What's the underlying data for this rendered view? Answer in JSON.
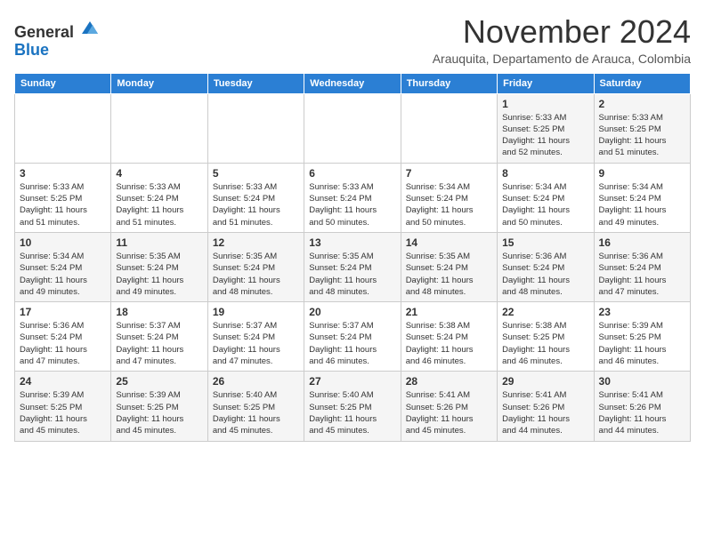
{
  "logo": {
    "general": "General",
    "blue": "Blue"
  },
  "title": "November 2024",
  "subtitle": "Arauquita, Departamento de Arauca, Colombia",
  "days_of_week": [
    "Sunday",
    "Monday",
    "Tuesday",
    "Wednesday",
    "Thursday",
    "Friday",
    "Saturday"
  ],
  "weeks": [
    [
      {
        "day": "",
        "info": ""
      },
      {
        "day": "",
        "info": ""
      },
      {
        "day": "",
        "info": ""
      },
      {
        "day": "",
        "info": ""
      },
      {
        "day": "",
        "info": ""
      },
      {
        "day": "1",
        "info": "Sunrise: 5:33 AM\nSunset: 5:25 PM\nDaylight: 11 hours\nand 52 minutes."
      },
      {
        "day": "2",
        "info": "Sunrise: 5:33 AM\nSunset: 5:25 PM\nDaylight: 11 hours\nand 51 minutes."
      }
    ],
    [
      {
        "day": "3",
        "info": "Sunrise: 5:33 AM\nSunset: 5:25 PM\nDaylight: 11 hours\nand 51 minutes."
      },
      {
        "day": "4",
        "info": "Sunrise: 5:33 AM\nSunset: 5:24 PM\nDaylight: 11 hours\nand 51 minutes."
      },
      {
        "day": "5",
        "info": "Sunrise: 5:33 AM\nSunset: 5:24 PM\nDaylight: 11 hours\nand 51 minutes."
      },
      {
        "day": "6",
        "info": "Sunrise: 5:33 AM\nSunset: 5:24 PM\nDaylight: 11 hours\nand 50 minutes."
      },
      {
        "day": "7",
        "info": "Sunrise: 5:34 AM\nSunset: 5:24 PM\nDaylight: 11 hours\nand 50 minutes."
      },
      {
        "day": "8",
        "info": "Sunrise: 5:34 AM\nSunset: 5:24 PM\nDaylight: 11 hours\nand 50 minutes."
      },
      {
        "day": "9",
        "info": "Sunrise: 5:34 AM\nSunset: 5:24 PM\nDaylight: 11 hours\nand 49 minutes."
      }
    ],
    [
      {
        "day": "10",
        "info": "Sunrise: 5:34 AM\nSunset: 5:24 PM\nDaylight: 11 hours\nand 49 minutes."
      },
      {
        "day": "11",
        "info": "Sunrise: 5:35 AM\nSunset: 5:24 PM\nDaylight: 11 hours\nand 49 minutes."
      },
      {
        "day": "12",
        "info": "Sunrise: 5:35 AM\nSunset: 5:24 PM\nDaylight: 11 hours\nand 48 minutes."
      },
      {
        "day": "13",
        "info": "Sunrise: 5:35 AM\nSunset: 5:24 PM\nDaylight: 11 hours\nand 48 minutes."
      },
      {
        "day": "14",
        "info": "Sunrise: 5:35 AM\nSunset: 5:24 PM\nDaylight: 11 hours\nand 48 minutes."
      },
      {
        "day": "15",
        "info": "Sunrise: 5:36 AM\nSunset: 5:24 PM\nDaylight: 11 hours\nand 48 minutes."
      },
      {
        "day": "16",
        "info": "Sunrise: 5:36 AM\nSunset: 5:24 PM\nDaylight: 11 hours\nand 47 minutes."
      }
    ],
    [
      {
        "day": "17",
        "info": "Sunrise: 5:36 AM\nSunset: 5:24 PM\nDaylight: 11 hours\nand 47 minutes."
      },
      {
        "day": "18",
        "info": "Sunrise: 5:37 AM\nSunset: 5:24 PM\nDaylight: 11 hours\nand 47 minutes."
      },
      {
        "day": "19",
        "info": "Sunrise: 5:37 AM\nSunset: 5:24 PM\nDaylight: 11 hours\nand 47 minutes."
      },
      {
        "day": "20",
        "info": "Sunrise: 5:37 AM\nSunset: 5:24 PM\nDaylight: 11 hours\nand 46 minutes."
      },
      {
        "day": "21",
        "info": "Sunrise: 5:38 AM\nSunset: 5:24 PM\nDaylight: 11 hours\nand 46 minutes."
      },
      {
        "day": "22",
        "info": "Sunrise: 5:38 AM\nSunset: 5:25 PM\nDaylight: 11 hours\nand 46 minutes."
      },
      {
        "day": "23",
        "info": "Sunrise: 5:39 AM\nSunset: 5:25 PM\nDaylight: 11 hours\nand 46 minutes."
      }
    ],
    [
      {
        "day": "24",
        "info": "Sunrise: 5:39 AM\nSunset: 5:25 PM\nDaylight: 11 hours\nand 45 minutes."
      },
      {
        "day": "25",
        "info": "Sunrise: 5:39 AM\nSunset: 5:25 PM\nDaylight: 11 hours\nand 45 minutes."
      },
      {
        "day": "26",
        "info": "Sunrise: 5:40 AM\nSunset: 5:25 PM\nDaylight: 11 hours\nand 45 minutes."
      },
      {
        "day": "27",
        "info": "Sunrise: 5:40 AM\nSunset: 5:25 PM\nDaylight: 11 hours\nand 45 minutes."
      },
      {
        "day": "28",
        "info": "Sunrise: 5:41 AM\nSunset: 5:26 PM\nDaylight: 11 hours\nand 45 minutes."
      },
      {
        "day": "29",
        "info": "Sunrise: 5:41 AM\nSunset: 5:26 PM\nDaylight: 11 hours\nand 44 minutes."
      },
      {
        "day": "30",
        "info": "Sunrise: 5:41 AM\nSunset: 5:26 PM\nDaylight: 11 hours\nand 44 minutes."
      }
    ]
  ]
}
